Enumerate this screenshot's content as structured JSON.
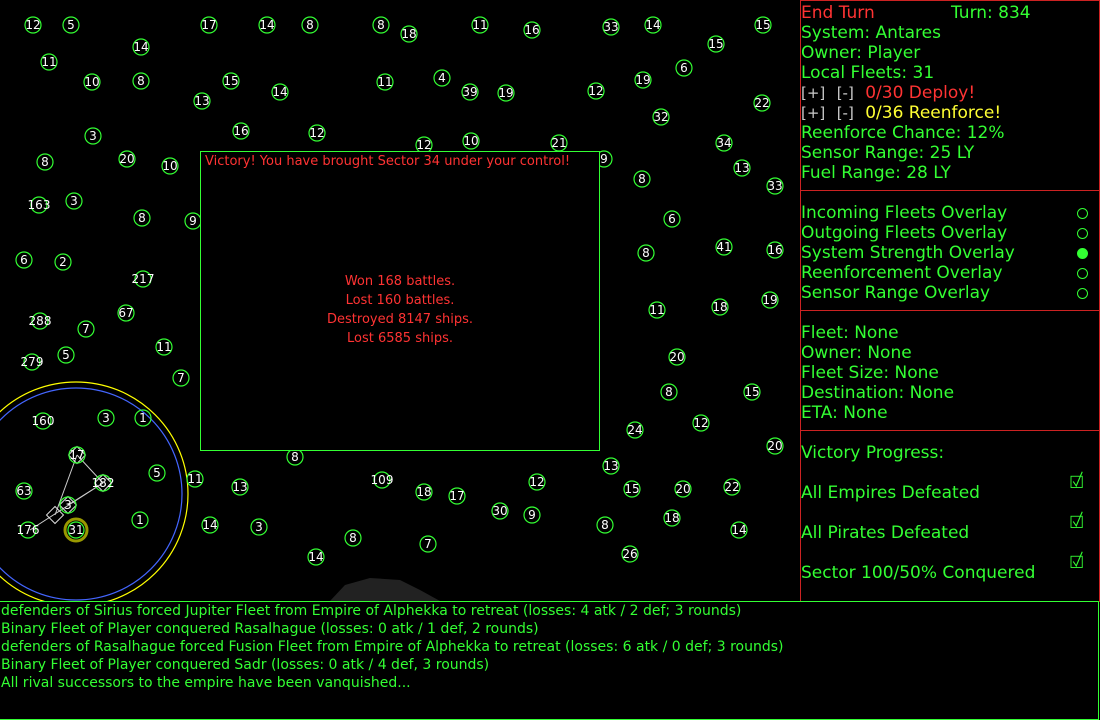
{
  "colors": {
    "accent_green": "#33ff33",
    "alert_red": "#ff3333",
    "warn_yellow": "#ffff33",
    "border_red": "#cc2222",
    "range_blue": "#4466ff",
    "range_yellow": "#ffff00"
  },
  "map": {
    "systems": [
      {
        "label": "12"
      },
      {
        "label": "5"
      },
      {
        "label": "17"
      },
      {
        "label": "14"
      },
      {
        "label": "8"
      },
      {
        "label": "8"
      },
      {
        "label": "18"
      },
      {
        "label": "11"
      },
      {
        "label": "16"
      },
      {
        "label": "33"
      },
      {
        "label": "14"
      },
      {
        "label": "15"
      },
      {
        "label": "14"
      },
      {
        "label": "11"
      },
      {
        "label": "15"
      },
      {
        "label": "10"
      },
      {
        "label": "8"
      },
      {
        "label": "15"
      },
      {
        "label": "13"
      },
      {
        "label": "14"
      },
      {
        "label": "11"
      },
      {
        "label": "4"
      },
      {
        "label": "39"
      },
      {
        "label": "19"
      },
      {
        "label": "12"
      },
      {
        "label": "6"
      },
      {
        "label": "19"
      },
      {
        "label": "22"
      },
      {
        "label": "32"
      },
      {
        "label": "3"
      },
      {
        "label": "16"
      },
      {
        "label": "12"
      },
      {
        "label": "12"
      },
      {
        "label": "10"
      },
      {
        "label": "21"
      },
      {
        "label": "34"
      },
      {
        "label": "8"
      },
      {
        "label": "20"
      },
      {
        "label": "10"
      },
      {
        "label": "9"
      },
      {
        "label": "13"
      },
      {
        "label": "8"
      },
      {
        "label": "33"
      },
      {
        "label": "163"
      },
      {
        "label": "3"
      },
      {
        "label": "8"
      },
      {
        "label": "9"
      },
      {
        "label": "6"
      },
      {
        "label": "6"
      },
      {
        "label": "2"
      },
      {
        "label": "217"
      },
      {
        "label": "8"
      },
      {
        "label": "41"
      },
      {
        "label": "16"
      },
      {
        "label": "288"
      },
      {
        "label": "7"
      },
      {
        "label": "67"
      },
      {
        "label": "11"
      },
      {
        "label": "18"
      },
      {
        "label": "19"
      },
      {
        "label": "279"
      },
      {
        "label": "5"
      },
      {
        "label": "11"
      },
      {
        "label": "7"
      },
      {
        "label": "20"
      },
      {
        "label": "8"
      },
      {
        "label": "15"
      },
      {
        "label": "160"
      },
      {
        "label": "3"
      },
      {
        "label": "1"
      },
      {
        "label": "24"
      },
      {
        "label": "12"
      },
      {
        "label": "20"
      },
      {
        "label": "17"
      },
      {
        "label": "8"
      },
      {
        "label": "5"
      },
      {
        "label": "11"
      },
      {
        "label": "13"
      },
      {
        "label": "109"
      },
      {
        "label": "18"
      },
      {
        "label": "17"
      },
      {
        "label": "12"
      },
      {
        "label": "13"
      },
      {
        "label": "15"
      },
      {
        "label": "20"
      },
      {
        "label": "22"
      },
      {
        "label": "63"
      },
      {
        "label": "182"
      },
      {
        "label": "3"
      },
      {
        "label": "30"
      },
      {
        "label": "9"
      },
      {
        "label": "8"
      },
      {
        "label": "18"
      },
      {
        "label": "14"
      },
      {
        "label": "1"
      },
      {
        "label": "14"
      },
      {
        "label": "3"
      },
      {
        "label": "176"
      },
      {
        "label": "31"
      },
      {
        "label": "8"
      },
      {
        "label": "7"
      },
      {
        "label": "14"
      },
      {
        "label": "26"
      }
    ],
    "victory_dialog": {
      "title": "Victory! You have brought Sector 34 under your control!",
      "won": "Won 168 battles.",
      "lost": "Lost 160 battles.",
      "destroyed": "Destroyed 8147 ships.",
      "ships_lost": "Lost 6585 ships."
    }
  },
  "panel_system": {
    "end_turn": "End Turn",
    "turn": "Turn: 834",
    "system": "System: Antares",
    "owner": "Owner: Player",
    "local_fleets": "Local Fleets: 31",
    "plus": "[+]",
    "minus": "[-]",
    "deploy": "0/30 Deploy!",
    "reenforce": "0/36 Reenforce!",
    "reenforce_chance": "Reenforce Chance: 12%",
    "sensor_range": "Sensor Range: 25 LY",
    "fuel_range": "Fuel Range: 28 LY"
  },
  "panel_overlays": {
    "items": [
      {
        "label": "Incoming Fleets Overlay",
        "selected": false
      },
      {
        "label": "Outgoing Fleets Overlay",
        "selected": false
      },
      {
        "label": "System Strength Overlay",
        "selected": true
      },
      {
        "label": "Reenforcement Overlay",
        "selected": false
      },
      {
        "label": "Sensor Range Overlay",
        "selected": false
      }
    ]
  },
  "panel_fleet": {
    "fleet": "Fleet: None",
    "owner": "Owner: None",
    "size": "Fleet Size: None",
    "destination": "Destination: None",
    "eta": "ETA: None"
  },
  "panel_victory": {
    "title": "Victory Progress:",
    "items": [
      {
        "label": "All Empires Defeated",
        "checked": true
      },
      {
        "label": "All Pirates Defeated",
        "checked": true
      },
      {
        "label": "Sector 100/50% Conquered",
        "checked": true
      }
    ]
  },
  "log": {
    "lines": [
      "defenders of Sirius forced Jupiter Fleet from Empire of Alphekka to retreat (losses: 4 atk / 2 def; 3 rounds)",
      "Binary Fleet of Player conquered Rasalhague (losses: 0 atk / 1 def, 2 rounds)",
      "defenders of Rasalhague forced Fusion Fleet from Empire of Alphekka to retreat (losses: 6 atk / 0 def; 3 rounds)",
      "Binary Fleet of Player conquered Sadr (losses: 0 atk / 4 def, 3 rounds)",
      "All rival successors to the empire have been vanquished..."
    ]
  }
}
